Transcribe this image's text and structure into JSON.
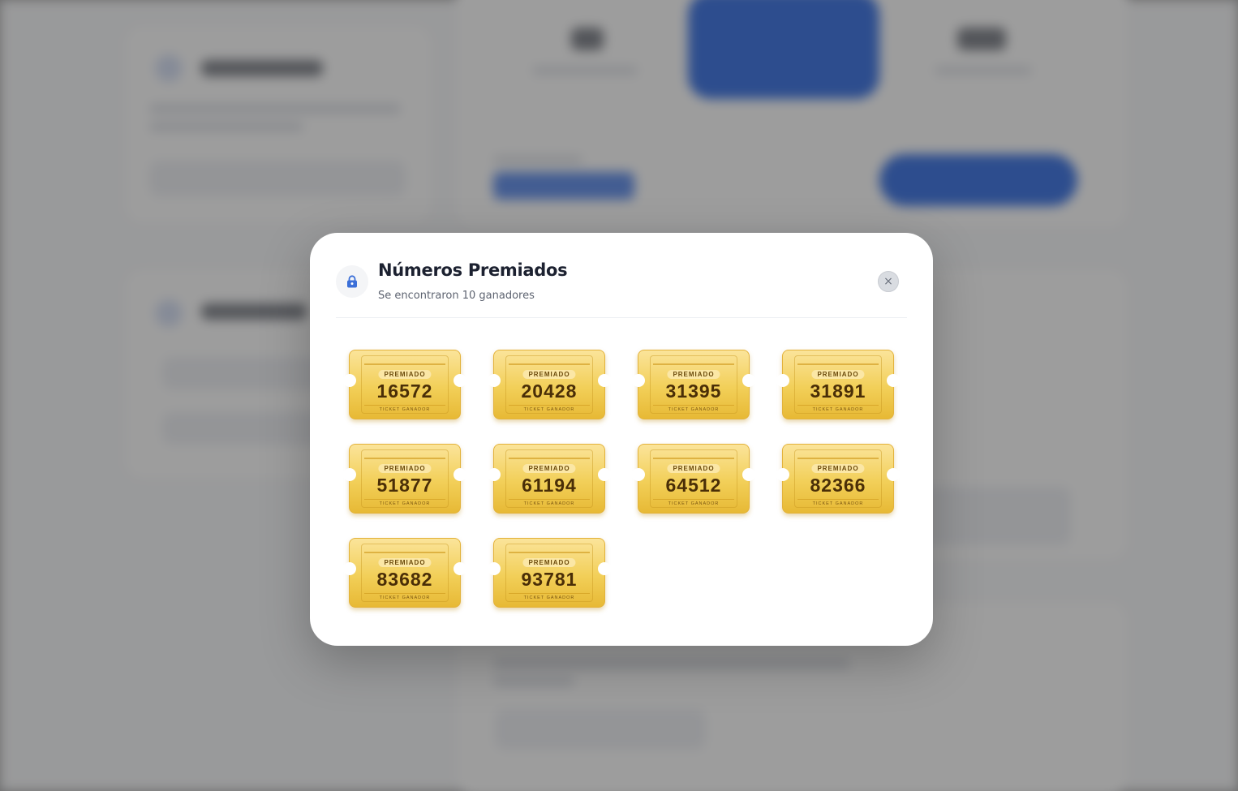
{
  "modal": {
    "title": "Números Premiados",
    "subtitle": "Se encontraron 10 ganadores",
    "header_icon": "lock-icon",
    "close_icon": "close-icon",
    "close_label": "×"
  },
  "tickets": [
    {
      "badge": "PREMIADO",
      "number": "16572",
      "caption": "TICKET GANADOR"
    },
    {
      "badge": "PREMIADO",
      "number": "20428",
      "caption": "TICKET GANADOR"
    },
    {
      "badge": "PREMIADO",
      "number": "31395",
      "caption": "TICKET GANADOR"
    },
    {
      "badge": "PREMIADO",
      "number": "31891",
      "caption": "TICKET GANADOR"
    },
    {
      "badge": "PREMIADO",
      "number": "51877",
      "caption": "TICKET GANADOR"
    },
    {
      "badge": "PREMIADO",
      "number": "61194",
      "caption": "TICKET GANADOR"
    },
    {
      "badge": "PREMIADO",
      "number": "64512",
      "caption": "TICKET GANADOR"
    },
    {
      "badge": "PREMIADO",
      "number": "82366",
      "caption": "TICKET GANADOR"
    },
    {
      "badge": "PREMIADO",
      "number": "83682",
      "caption": "TICKET GANADOR"
    },
    {
      "badge": "PREMIADO",
      "number": "93781",
      "caption": "TICKET GANADOR"
    }
  ],
  "colors": {
    "ticket_gold": "#f2cf58",
    "ticket_text": "#4a2e07",
    "brand_blue": "#1f5fe0",
    "overlay": "#9b9b9b"
  }
}
